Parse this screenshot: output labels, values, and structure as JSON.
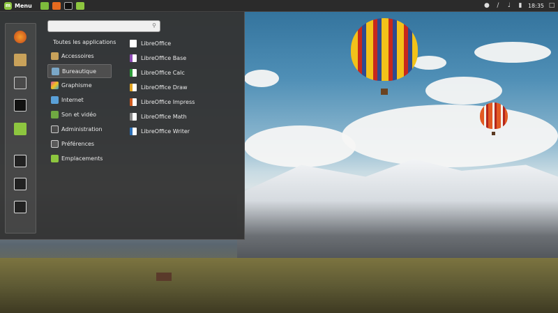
{
  "panel": {
    "menu_label": "Menu",
    "clock": "18:35",
    "launchers": [
      {
        "icon": "file-manager-icon",
        "color": "#7dbb3c"
      },
      {
        "icon": "firefox-icon",
        "color": "#e66a1f"
      },
      {
        "icon": "terminal-icon",
        "color": "#333333"
      },
      {
        "icon": "folder-icon",
        "color": "#8dc63f"
      }
    ],
    "tray_icons": [
      "user-icon",
      "network-icon",
      "volume-icon",
      "battery-icon",
      "notifications-icon"
    ]
  },
  "start_menu": {
    "search": {
      "value": "",
      "placeholder": ""
    },
    "favorites": [
      {
        "icon": "firefox-icon",
        "color": "#e66a1f"
      },
      {
        "icon": "package-icon",
        "color": "#c9a25a"
      },
      {
        "icon": "settings-icon",
        "color": "#cfcfcf"
      },
      {
        "icon": "terminal-icon",
        "color": "#222222"
      },
      {
        "icon": "folder-icon",
        "color": "#8dc63f"
      },
      {
        "icon": "lock-screen-icon",
        "color": "#e0e0e0"
      },
      {
        "icon": "logout-icon",
        "color": "#e0e0e0"
      },
      {
        "icon": "shutdown-icon",
        "color": "#e0e0e0"
      }
    ],
    "all_apps_label": "Toutes les applications",
    "categories": [
      {
        "label": "Accessoires",
        "icon": "accessories-icon",
        "color": "#c9a25a"
      },
      {
        "label": "Bureautique",
        "icon": "office-icon",
        "color": "#7aa7c7",
        "active": true
      },
      {
        "label": "Graphisme",
        "icon": "graphics-icon",
        "color": "#d94f9c"
      },
      {
        "label": "Internet",
        "icon": "internet-icon",
        "color": "#5aa0d8"
      },
      {
        "label": "Son et vidéo",
        "icon": "multimedia-icon",
        "color": "#6fa842"
      },
      {
        "label": "Administration",
        "icon": "administration-icon",
        "color": "#cfcfcf"
      },
      {
        "label": "Préférences",
        "icon": "preferences-icon",
        "color": "#cfcfcf"
      },
      {
        "label": "Emplacements",
        "icon": "places-icon",
        "color": "#8dc63f"
      }
    ],
    "apps": [
      {
        "label": "LibreOffice",
        "icon": "libreoffice-icon",
        "color": "#ffffff"
      },
      {
        "label": "LibreOffice Base",
        "icon": "libreoffice-base-icon",
        "color": "#8e4ab5"
      },
      {
        "label": "LibreOffice Calc",
        "icon": "libreoffice-calc-icon",
        "color": "#2d9c3a"
      },
      {
        "label": "LibreOffice Draw",
        "icon": "libreoffice-draw-icon",
        "color": "#e1a320"
      },
      {
        "label": "LibreOffice Impress",
        "icon": "libreoffice-impress-icon",
        "color": "#d05b1f"
      },
      {
        "label": "LibreOffice Math",
        "icon": "libreoffice-math-icon",
        "color": "#888888"
      },
      {
        "label": "LibreOffice Writer",
        "icon": "libreoffice-writer-icon",
        "color": "#2c6fb5"
      }
    ]
  }
}
